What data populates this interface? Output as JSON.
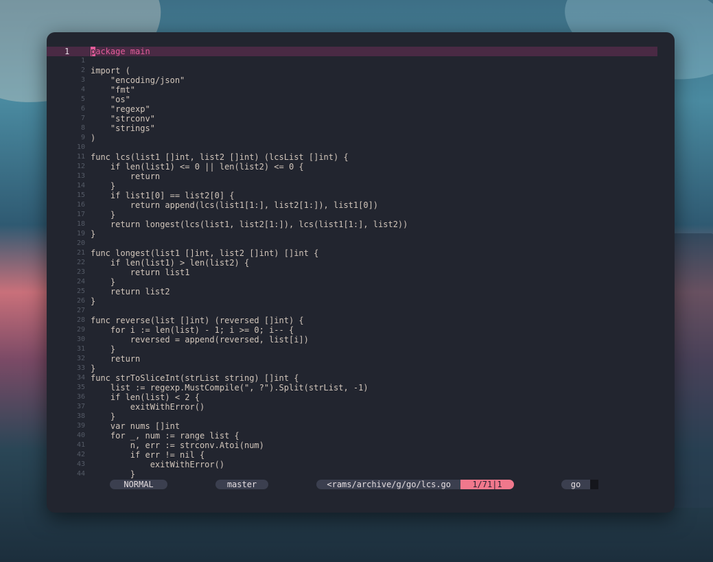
{
  "editor": {
    "current_line_number": "1",
    "lines": [
      {
        "n": "1",
        "text": "package main"
      },
      {
        "n": "1",
        "text": ""
      },
      {
        "n": "2",
        "text": "import ("
      },
      {
        "n": "3",
        "text": "    \"encoding/json\""
      },
      {
        "n": "4",
        "text": "    \"fmt\""
      },
      {
        "n": "5",
        "text": "    \"os\""
      },
      {
        "n": "6",
        "text": "    \"regexp\""
      },
      {
        "n": "7",
        "text": "    \"strconv\""
      },
      {
        "n": "8",
        "text": "    \"strings\""
      },
      {
        "n": "9",
        "text": ")"
      },
      {
        "n": "10",
        "text": ""
      },
      {
        "n": "11",
        "text": "func lcs(list1 []int, list2 []int) (lcsList []int) {"
      },
      {
        "n": "12",
        "text": "    if len(list1) <= 0 || len(list2) <= 0 {"
      },
      {
        "n": "13",
        "text": "        return"
      },
      {
        "n": "14",
        "text": "    }"
      },
      {
        "n": "15",
        "text": "    if list1[0] == list2[0] {"
      },
      {
        "n": "16",
        "text": "        return append(lcs(list1[1:], list2[1:]), list1[0])"
      },
      {
        "n": "17",
        "text": "    }"
      },
      {
        "n": "18",
        "text": "    return longest(lcs(list1, list2[1:]), lcs(list1[1:], list2))"
      },
      {
        "n": "19",
        "text": "}"
      },
      {
        "n": "20",
        "text": ""
      },
      {
        "n": "21",
        "text": "func longest(list1 []int, list2 []int) []int {"
      },
      {
        "n": "22",
        "text": "    if len(list1) > len(list2) {"
      },
      {
        "n": "23",
        "text": "        return list1"
      },
      {
        "n": "24",
        "text": "    }"
      },
      {
        "n": "25",
        "text": "    return list2"
      },
      {
        "n": "26",
        "text": "}"
      },
      {
        "n": "27",
        "text": ""
      },
      {
        "n": "28",
        "text": "func reverse(list []int) (reversed []int) {"
      },
      {
        "n": "29",
        "text": "    for i := len(list) - 1; i >= 0; i-- {"
      },
      {
        "n": "30",
        "text": "        reversed = append(reversed, list[i])"
      },
      {
        "n": "31",
        "text": "    }"
      },
      {
        "n": "32",
        "text": "    return"
      },
      {
        "n": "33",
        "text": "}"
      },
      {
        "n": "34",
        "text": "func strToSliceInt(strList string) []int {"
      },
      {
        "n": "35",
        "text": "    list := regexp.MustCompile(\", ?\").Split(strList, -1)"
      },
      {
        "n": "36",
        "text": "    if len(list) < 2 {"
      },
      {
        "n": "37",
        "text": "        exitWithError()"
      },
      {
        "n": "38",
        "text": "    }"
      },
      {
        "n": "39",
        "text": "    var nums []int"
      },
      {
        "n": "40",
        "text": "    for _, num := range list {"
      },
      {
        "n": "41",
        "text": "        n, err := strconv.Atoi(num)"
      },
      {
        "n": "42",
        "text": "        if err != nil {"
      },
      {
        "n": "43",
        "text": "            exitWithError()"
      },
      {
        "n": "44",
        "text": "        }"
      }
    ]
  },
  "statusline": {
    "mode": "NORMAL",
    "branch": "master",
    "file": "<rams/archive/g/go/lcs.go",
    "position": "1/71|1",
    "filetype": "go"
  },
  "colors": {
    "background": "#22252f",
    "accent": "#e35c9a",
    "position_pill": "#f0788c"
  }
}
